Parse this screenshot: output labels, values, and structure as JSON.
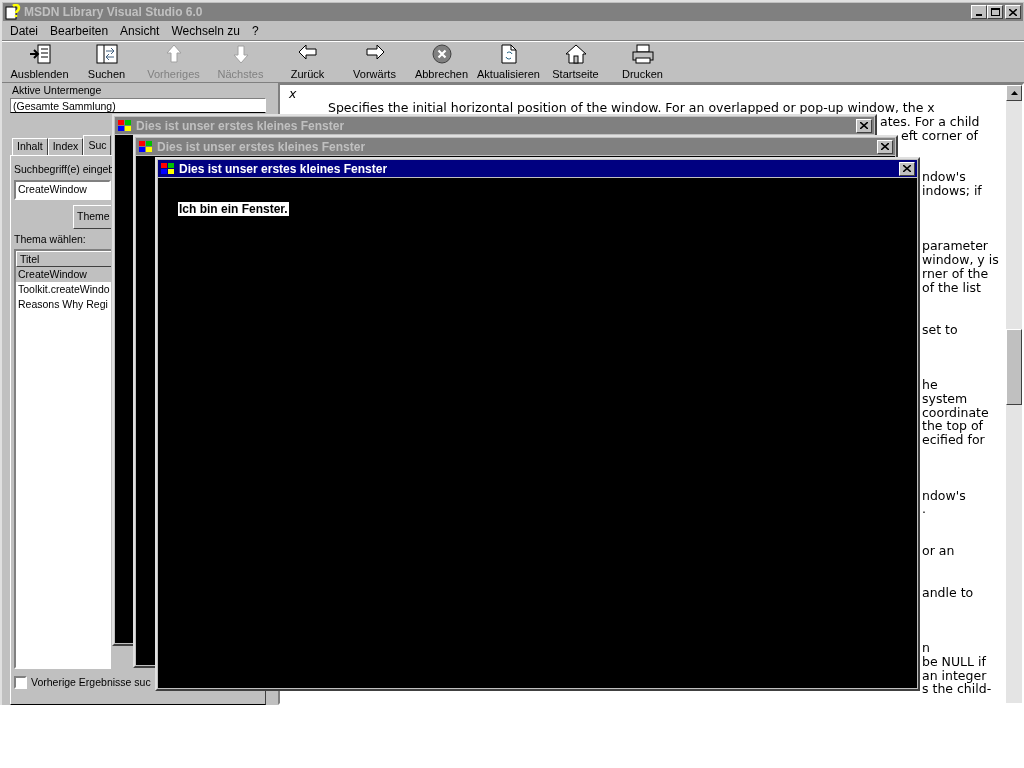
{
  "window": {
    "title": "MSDN Library Visual Studio 6.0",
    "active": false
  },
  "menu": [
    {
      "label": "Datei"
    },
    {
      "label": "Bearbeiten"
    },
    {
      "label": "Ansicht"
    },
    {
      "label": "Wechseln zu"
    },
    {
      "label": "?"
    }
  ],
  "toolbar": [
    {
      "label": "Ausblenden",
      "kind": "hide",
      "disabled": false
    },
    {
      "label": "Suchen",
      "kind": "search",
      "disabled": false
    },
    {
      "label": "Vorheriges",
      "kind": "up",
      "disabled": true
    },
    {
      "label": "Nächstes",
      "kind": "down",
      "disabled": true
    },
    {
      "label": "Zurück",
      "kind": "back",
      "disabled": false
    },
    {
      "label": "Vorwärts",
      "kind": "forward",
      "disabled": false
    },
    {
      "label": "Abbrechen",
      "kind": "stop",
      "disabled": false
    },
    {
      "label": "Aktualisieren",
      "kind": "refresh",
      "disabled": false
    },
    {
      "label": "Startseite",
      "kind": "home",
      "disabled": false
    },
    {
      "label": "Drucken",
      "kind": "print",
      "disabled": false
    }
  ],
  "left_pane": {
    "subset_label": "Aktive Untermenge",
    "subset_value": "(Gesamte Sammlung)",
    "tabs": [
      {
        "label": "Inhalt",
        "selected": false
      },
      {
        "label": "Index",
        "selected": false
      },
      {
        "label": "Suc",
        "selected": true
      }
    ],
    "search_label": "Suchbegriff(e) eingeb",
    "search_value": "CreateWindow",
    "topics_button": "Theme",
    "topic_label": "Thema wählen:",
    "list_header": "Titel",
    "topics": [
      {
        "label": "CreateWindow",
        "selected": true
      },
      {
        "label": "Toolkit.createWindo",
        "selected": false
      },
      {
        "label": "Reasons Why Regi",
        "selected": false
      }
    ],
    "checkboxes": [
      {
        "label": "Vorherige Ergebnisse suc",
        "checked": false
      }
    ]
  },
  "document": {
    "param": "x",
    "first_line": "Specifies the initial horizontal position of the window. For an overlapped or pop-up window, the x",
    "fragments": [
      "ates. For a child",
      "eft corner of",
      "ndow's",
      "indows; if",
      "parameter",
      "window, y is",
      "rner of the",
      "of the list",
      "set to",
      "he",
      "system",
      "coordinate",
      "the top of",
      "ecified for",
      "ndow's",
      ".",
      "or an",
      "andle to",
      "n",
      "be NULL if",
      "an integer",
      "s the child-"
    ]
  },
  "child_windows": [
    {
      "title": "Dies ist unser erstes kleines Fenster",
      "active": false
    },
    {
      "title": "Dies ist unser erstes kleines Fenster",
      "active": false
    },
    {
      "title": "Dies ist unser erstes kleines Fenster",
      "active": true,
      "body_text": "Ich bin ein Fenster."
    }
  ]
}
